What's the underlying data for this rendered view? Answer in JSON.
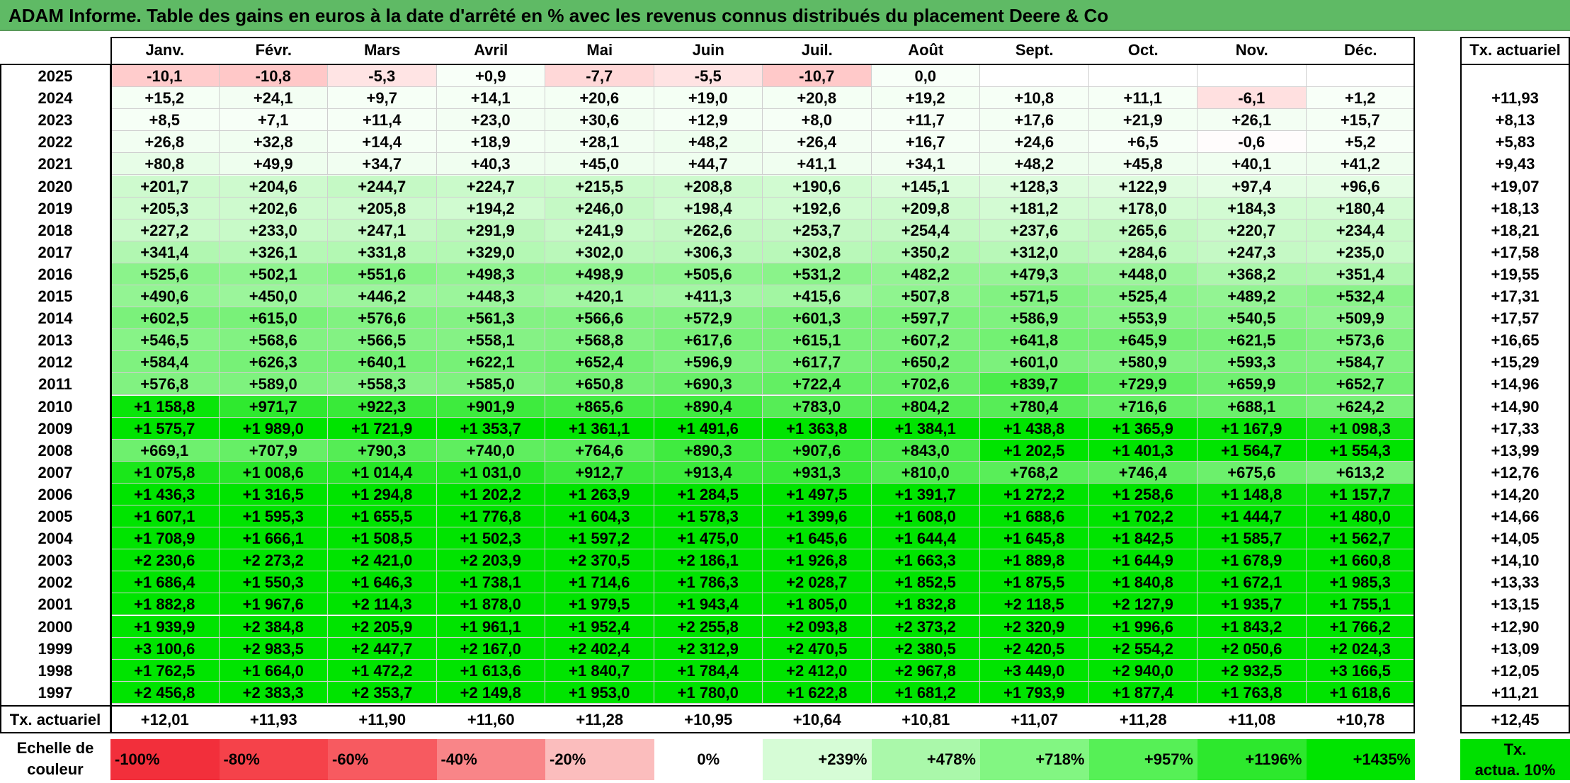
{
  "title": "ADAM Informe. Table des gains en euros à la date d'arrêté en % avec les revenus connus distribués du placement Deere & Co",
  "months": [
    "Janv.",
    "Févr.",
    "Mars",
    "Avril",
    "Mai",
    "Juin",
    "Juil.",
    "Août",
    "Sept.",
    "Oct.",
    "Nov.",
    "Déc."
  ],
  "rate_header": "Tx. actuariel",
  "rows": [
    {
      "year": "2025",
      "values": [
        "-10,1",
        "-10,8",
        "-5,3",
        "+0,9",
        "-7,7",
        "-5,5",
        "-10,7",
        "0,0",
        "",
        "",
        "",
        ""
      ],
      "rate": ""
    },
    {
      "year": "2024",
      "values": [
        "+15,2",
        "+24,1",
        "+9,7",
        "+14,1",
        "+20,6",
        "+19,0",
        "+20,8",
        "+19,2",
        "+10,8",
        "+11,1",
        "-6,1",
        "+1,2"
      ],
      "rate": "+11,93"
    },
    {
      "year": "2023",
      "values": [
        "+8,5",
        "+7,1",
        "+11,4",
        "+23,0",
        "+30,6",
        "+12,9",
        "+8,0",
        "+11,7",
        "+17,6",
        "+21,9",
        "+26,1",
        "+15,7"
      ],
      "rate": "+8,13"
    },
    {
      "year": "2022",
      "values": [
        "+26,8",
        "+32,8",
        "+14,4",
        "+18,9",
        "+28,1",
        "+48,2",
        "+26,4",
        "+16,7",
        "+24,6",
        "+6,5",
        "-0,6",
        "+5,2"
      ],
      "rate": "+5,83"
    },
    {
      "year": "2021",
      "values": [
        "+80,8",
        "+49,9",
        "+34,7",
        "+40,3",
        "+45,0",
        "+44,7",
        "+41,1",
        "+34,1",
        "+48,2",
        "+45,8",
        "+40,1",
        "+41,2"
      ],
      "rate": "+9,43"
    },
    {
      "year": "2020",
      "values": [
        "+201,7",
        "+204,6",
        "+244,7",
        "+224,7",
        "+215,5",
        "+208,8",
        "+190,6",
        "+145,1",
        "+128,3",
        "+122,9",
        "+97,4",
        "+96,6"
      ],
      "rate": "+19,07"
    },
    {
      "year": "2019",
      "values": [
        "+205,3",
        "+202,6",
        "+205,8",
        "+194,2",
        "+246,0",
        "+198,4",
        "+192,6",
        "+209,8",
        "+181,2",
        "+178,0",
        "+184,3",
        "+180,4"
      ],
      "rate": "+18,13"
    },
    {
      "year": "2018",
      "values": [
        "+227,2",
        "+233,0",
        "+247,1",
        "+291,9",
        "+241,9",
        "+262,6",
        "+253,7",
        "+254,4",
        "+237,6",
        "+265,6",
        "+220,7",
        "+234,4"
      ],
      "rate": "+18,21"
    },
    {
      "year": "2017",
      "values": [
        "+341,4",
        "+326,1",
        "+331,8",
        "+329,0",
        "+302,0",
        "+306,3",
        "+302,8",
        "+350,2",
        "+312,0",
        "+284,6",
        "+247,3",
        "+235,0"
      ],
      "rate": "+17,58"
    },
    {
      "year": "2016",
      "values": [
        "+525,6",
        "+502,1",
        "+551,6",
        "+498,3",
        "+498,9",
        "+505,6",
        "+531,2",
        "+482,2",
        "+479,3",
        "+448,0",
        "+368,2",
        "+351,4"
      ],
      "rate": "+19,55"
    },
    {
      "year": "2015",
      "values": [
        "+490,6",
        "+450,0",
        "+446,2",
        "+448,3",
        "+420,1",
        "+411,3",
        "+415,6",
        "+507,8",
        "+571,5",
        "+525,4",
        "+489,2",
        "+532,4"
      ],
      "rate": "+17,31"
    },
    {
      "year": "2014",
      "values": [
        "+602,5",
        "+615,0",
        "+576,6",
        "+561,3",
        "+566,6",
        "+572,9",
        "+601,3",
        "+597,7",
        "+586,9",
        "+553,9",
        "+540,5",
        "+509,9"
      ],
      "rate": "+17,57"
    },
    {
      "year": "2013",
      "values": [
        "+546,5",
        "+568,6",
        "+566,5",
        "+558,1",
        "+568,8",
        "+617,6",
        "+615,1",
        "+607,2",
        "+641,8",
        "+645,9",
        "+621,5",
        "+573,6"
      ],
      "rate": "+16,65"
    },
    {
      "year": "2012",
      "values": [
        "+584,4",
        "+626,3",
        "+640,1",
        "+622,1",
        "+652,4",
        "+596,9",
        "+617,7",
        "+650,2",
        "+601,0",
        "+580,9",
        "+593,3",
        "+584,7"
      ],
      "rate": "+15,29"
    },
    {
      "year": "2011",
      "values": [
        "+576,8",
        "+589,0",
        "+558,3",
        "+585,0",
        "+650,8",
        "+690,3",
        "+722,4",
        "+702,6",
        "+839,7",
        "+729,9",
        "+659,9",
        "+652,7"
      ],
      "rate": "+14,96"
    },
    {
      "year": "2010",
      "values": [
        "+1 158,8",
        "+971,7",
        "+922,3",
        "+901,9",
        "+865,6",
        "+890,4",
        "+783,0",
        "+804,2",
        "+780,4",
        "+716,6",
        "+688,1",
        "+624,2"
      ],
      "rate": "+14,90"
    },
    {
      "year": "2009",
      "values": [
        "+1 575,7",
        "+1 989,0",
        "+1 721,9",
        "+1 353,7",
        "+1 361,1",
        "+1 491,6",
        "+1 363,8",
        "+1 384,1",
        "+1 438,8",
        "+1 365,9",
        "+1 167,9",
        "+1 098,3"
      ],
      "rate": "+17,33"
    },
    {
      "year": "2008",
      "values": [
        "+669,1",
        "+707,9",
        "+790,3",
        "+740,0",
        "+764,6",
        "+890,3",
        "+907,6",
        "+843,0",
        "+1 202,5",
        "+1 401,3",
        "+1 564,7",
        "+1 554,3"
      ],
      "rate": "+13,99"
    },
    {
      "year": "2007",
      "values": [
        "+1 075,8",
        "+1 008,6",
        "+1 014,4",
        "+1 031,0",
        "+912,7",
        "+913,4",
        "+931,3",
        "+810,0",
        "+768,2",
        "+746,4",
        "+675,6",
        "+613,2"
      ],
      "rate": "+12,76"
    },
    {
      "year": "2006",
      "values": [
        "+1 436,3",
        "+1 316,5",
        "+1 294,8",
        "+1 202,2",
        "+1 263,9",
        "+1 284,5",
        "+1 497,5",
        "+1 391,7",
        "+1 272,2",
        "+1 258,6",
        "+1 148,8",
        "+1 157,7"
      ],
      "rate": "+14,20"
    },
    {
      "year": "2005",
      "values": [
        "+1 607,1",
        "+1 595,3",
        "+1 655,5",
        "+1 776,8",
        "+1 604,3",
        "+1 578,3",
        "+1 399,6",
        "+1 608,0",
        "+1 688,6",
        "+1 702,2",
        "+1 444,7",
        "+1 480,0"
      ],
      "rate": "+14,66"
    },
    {
      "year": "2004",
      "values": [
        "+1 708,9",
        "+1 666,1",
        "+1 508,5",
        "+1 502,3",
        "+1 597,2",
        "+1 475,0",
        "+1 645,6",
        "+1 644,4",
        "+1 645,8",
        "+1 842,5",
        "+1 585,7",
        "+1 562,7"
      ],
      "rate": "+14,05"
    },
    {
      "year": "2003",
      "values": [
        "+2 230,6",
        "+2 273,2",
        "+2 421,0",
        "+2 203,9",
        "+2 370,5",
        "+2 186,1",
        "+1 926,8",
        "+1 663,3",
        "+1 889,8",
        "+1 644,9",
        "+1 678,9",
        "+1 660,8"
      ],
      "rate": "+14,10"
    },
    {
      "year": "2002",
      "values": [
        "+1 686,4",
        "+1 550,3",
        "+1 646,3",
        "+1 738,1",
        "+1 714,6",
        "+1 786,3",
        "+2 028,7",
        "+1 852,5",
        "+1 875,5",
        "+1 840,8",
        "+1 672,1",
        "+1 985,3"
      ],
      "rate": "+13,33"
    },
    {
      "year": "2001",
      "values": [
        "+1 882,8",
        "+1 967,6",
        "+2 114,3",
        "+1 878,0",
        "+1 979,5",
        "+1 943,4",
        "+1 805,0",
        "+1 832,8",
        "+2 118,5",
        "+2 127,9",
        "+1 935,7",
        "+1 755,1"
      ],
      "rate": "+13,15"
    },
    {
      "year": "2000",
      "values": [
        "+1 939,9",
        "+2 384,8",
        "+2 205,9",
        "+1 961,1",
        "+1 952,4",
        "+2 255,8",
        "+2 093,8",
        "+2 373,2",
        "+2 320,9",
        "+1 996,6",
        "+1 843,2",
        "+1 766,2"
      ],
      "rate": "+12,90"
    },
    {
      "year": "1999",
      "values": [
        "+3 100,6",
        "+2 983,5",
        "+2 447,7",
        "+2 167,0",
        "+2 402,4",
        "+2 312,9",
        "+2 470,5",
        "+2 380,5",
        "+2 420,5",
        "+2 554,2",
        "+2 050,6",
        "+2 024,3"
      ],
      "rate": "+13,09"
    },
    {
      "year": "1998",
      "values": [
        "+1 762,5",
        "+1 664,0",
        "+1 472,2",
        "+1 613,6",
        "+1 840,7",
        "+1 784,4",
        "+2 412,0",
        "+2 967,8",
        "+3 449,0",
        "+2 940,0",
        "+2 932,5",
        "+3 166,5"
      ],
      "rate": "+12,05"
    },
    {
      "year": "1997",
      "values": [
        "+2 456,8",
        "+2 383,3",
        "+2 353,7",
        "+2 149,8",
        "+1 953,0",
        "+1 780,0",
        "+1 622,8",
        "+1 681,2",
        "+1 793,9",
        "+1 877,4",
        "+1 763,8",
        "+1 618,6"
      ],
      "rate": "+11,21"
    }
  ],
  "footer": {
    "label": "Tx. actuariel",
    "values": [
      "+12,01",
      "+11,93",
      "+11,90",
      "+11,60",
      "+11,28",
      "+10,95",
      "+10,64",
      "+10,81",
      "+11,07",
      "+11,28",
      "+11,08",
      "+10,78"
    ],
    "total": "+12,45"
  },
  "legend": {
    "label_line1": "Echelle de",
    "label_line2": "couleur",
    "items": [
      "-100%",
      "-80%",
      "-60%",
      "-40%",
      "-20%",
      "0%",
      "+239%",
      "+478%",
      "+718%",
      "+957%",
      "+1196%",
      "+1435%"
    ],
    "colors": [
      "#f22f3b",
      "#f5424a",
      "#f75a60",
      "#f98588",
      "#fbbdbd",
      "#ffffff",
      "#d6fcd6",
      "#aaf8aa",
      "#82f682",
      "#56f056",
      "#2de82d",
      "#00e400"
    ],
    "rate_line1": "Tx.",
    "rate_line2": "actua. 10%",
    "rate_color": "#00e000"
  }
}
